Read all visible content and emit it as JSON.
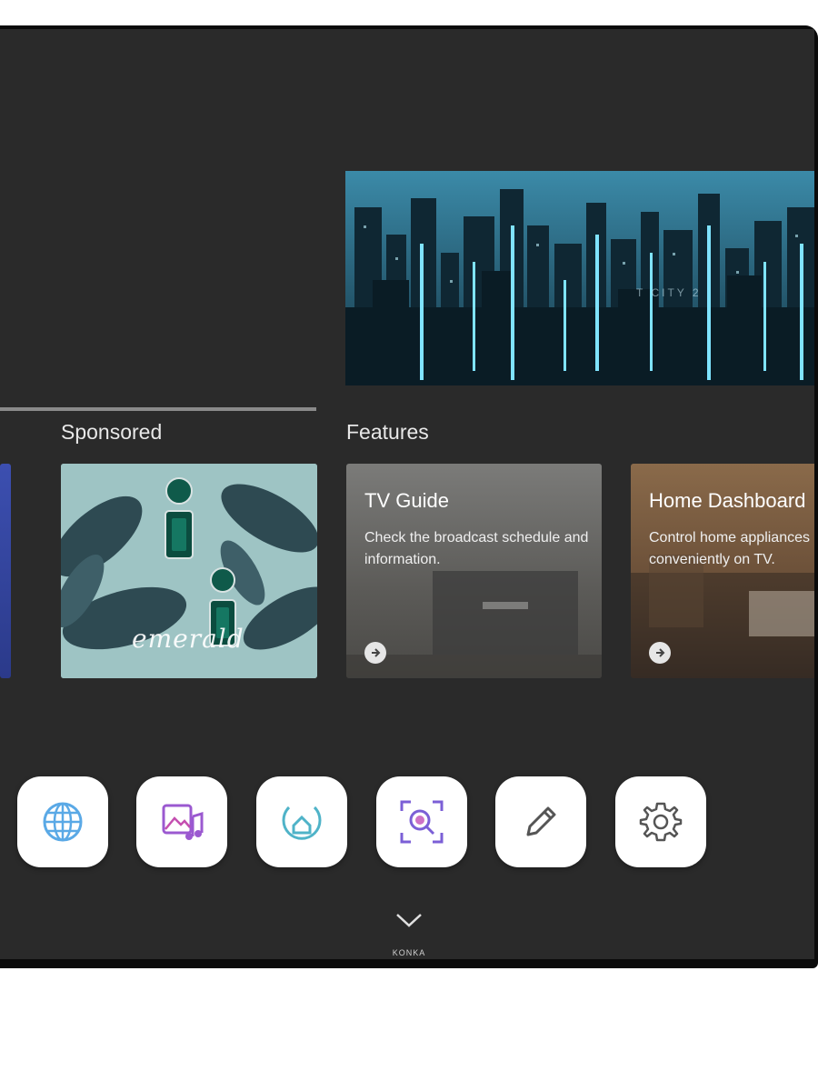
{
  "hero": {
    "watermark": "T    CITY  2"
  },
  "sections": {
    "sponsored": "Sponsored",
    "features": "Features"
  },
  "sponsored_card": {
    "overlay_text": "emerald"
  },
  "features": [
    {
      "title": "TV Guide",
      "description": "Check the broadcast schedule and information."
    },
    {
      "title": "Home Dashboard",
      "description": "Control home appliances conveniently on TV."
    }
  ],
  "dock": [
    {
      "icon": "globe-icon",
      "color": "#5aa9e6"
    },
    {
      "icon": "media-music-icon",
      "color": "#9b59d0"
    },
    {
      "icon": "home-hub-icon",
      "color": "#4fb3c8"
    },
    {
      "icon": "search-scan-icon",
      "color": "#7b5fd6"
    },
    {
      "icon": "pencil-icon",
      "color": "#555555"
    },
    {
      "icon": "gear-icon",
      "color": "#555555"
    }
  ],
  "brand": "KONKA"
}
